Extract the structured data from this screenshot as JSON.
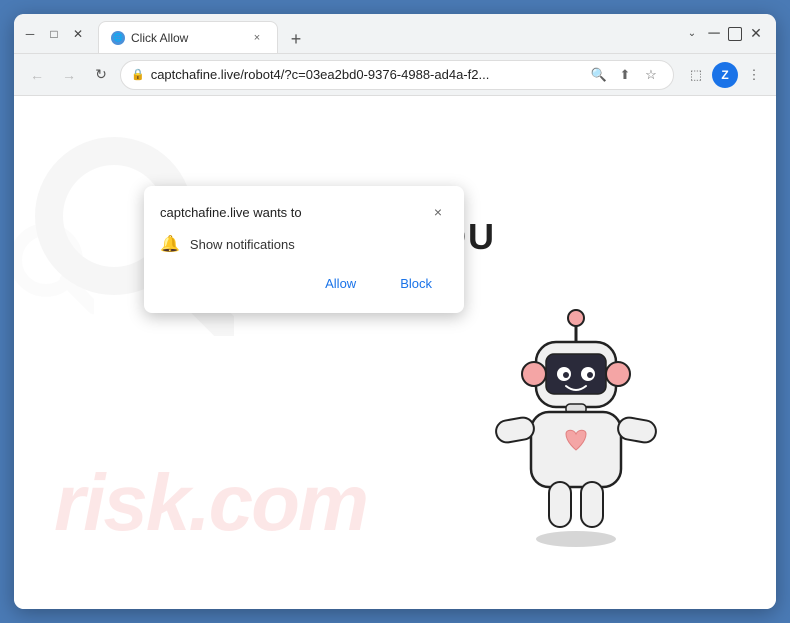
{
  "browser": {
    "title": "Click Allow",
    "tab": {
      "label": "Click Allow",
      "close_label": "×"
    },
    "new_tab_label": "+",
    "address_bar": {
      "url": "captchafine.live/robot4/?c=03ea2bd0-9376-4988-ad4a-f2...",
      "lock_symbol": "🔒"
    },
    "nav": {
      "back": "←",
      "forward": "→",
      "refresh": "↻"
    },
    "profile_letter": "Z",
    "window_controls": {
      "minimize": "─",
      "maximize": "□",
      "close": "✕"
    }
  },
  "notification_popup": {
    "title": "captchafine.live wants to",
    "close_label": "×",
    "notification_icon": "🔔",
    "notification_text": "Show notifications",
    "allow_label": "Allow",
    "block_label": "Block"
  },
  "page": {
    "you_text": "YOU",
    "watermark": "risk.com"
  }
}
